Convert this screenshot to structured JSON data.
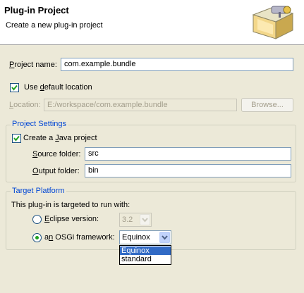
{
  "header": {
    "title": "Plug-in Project",
    "description": "Create a new plug-in project",
    "icon": "plugin-folder-wizard-icon"
  },
  "project_name": {
    "label_u": "P",
    "label_rest": "roject name:",
    "value": "com.example.bundle"
  },
  "use_default": {
    "label_pre": "Use ",
    "label_u": "d",
    "label_post": "efault location",
    "checked": true
  },
  "location": {
    "label_u": "L",
    "label_rest": "ocation:",
    "value": "E:/workspace/com.example.bundle",
    "browse_label": "Browse..."
  },
  "project_settings": {
    "title": "Project Settings",
    "create_java": {
      "label_pre": "Create a ",
      "label_u": "J",
      "label_post": "ava project",
      "checked": true
    },
    "source_folder": {
      "label_u": "S",
      "label_rest": "ource folder:",
      "value": "src"
    },
    "output_folder": {
      "label_u": "O",
      "label_rest": "utput folder:",
      "value": "bin"
    }
  },
  "target_platform": {
    "title": "Target Platform",
    "intro": "This plug-in is targeted to run with:",
    "eclipse": {
      "label_u": "E",
      "label_rest": "clipse version:",
      "selected": false,
      "version": "3.2"
    },
    "osgi": {
      "label_pre": "a",
      "label_u": "n",
      "label_post": " OSGi framework:",
      "selected": true,
      "value": "Equinox",
      "options": [
        "Equinox",
        "standard"
      ],
      "highlighted": "Equinox"
    }
  },
  "colors": {
    "group_title": "#0046d5",
    "dialog_bg": "#ece9d8",
    "selection": "#316ac5",
    "check": "#21a121"
  }
}
